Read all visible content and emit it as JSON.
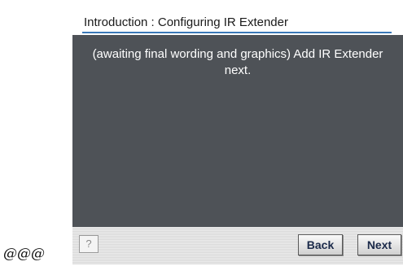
{
  "stray_text": "@@@",
  "dialog": {
    "title": "Introduction : Configuring IR Extender",
    "message": "(awaiting final wording and graphics) Add IR Extender next."
  },
  "footer": {
    "help_label": "?",
    "back_label": "Back",
    "next_label": "Next"
  },
  "colors": {
    "content_background": "#4e5257",
    "title_underline": "#3a78b8",
    "button_text": "#1b2a4a"
  }
}
